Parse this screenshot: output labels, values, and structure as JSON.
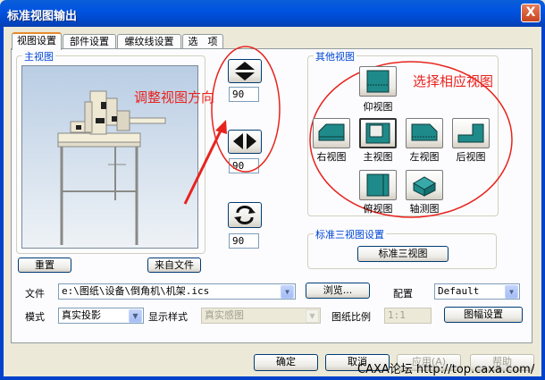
{
  "window": {
    "title": "标准视图输出",
    "close_label": "X"
  },
  "tabs": [
    "视图设置",
    "部件设置",
    "螺纹线设置",
    "选　项"
  ],
  "main_view": {
    "label": "主视图",
    "reset_label": "重置",
    "from_file_label": "来自文件"
  },
  "rotation": {
    "vertical_value": "90",
    "horizontal_value": "90",
    "spin_value": "90"
  },
  "other_views": {
    "label": "其他视图",
    "top": "仰视图",
    "right": "右视图",
    "front": "主视图",
    "left": "左视图",
    "back": "后视图",
    "bottom": "俯视图",
    "iso": "轴测图"
  },
  "standard_three": {
    "label": "标准三视图设置",
    "button_label": "标准三视图"
  },
  "annotations": {
    "adjust": "调整视图方向",
    "choose": "选择相应视图"
  },
  "form": {
    "file_label": "文件",
    "file_value": "e:\\图纸\\设备\\倒角机\\机架.ics",
    "browse_label": "浏览...",
    "config_label": "配置",
    "config_value": "Default",
    "mode_label": "模式",
    "mode_value": "真实投影",
    "display_label": "显示样式",
    "display_value": "真实感图",
    "scale_label": "图纸比例",
    "scale_value": "1:1",
    "sheet_button": "图幅设置"
  },
  "footer": {
    "ok": "确定",
    "cancel": "取消",
    "apply": "应用(A)",
    "help": "帮助"
  },
  "watermark": "CAXA论坛 http://top.caxa.com/",
  "colors": {
    "title_bar": "#0053e1",
    "annotation_red": "#e8231d",
    "group_label": "#0046d5",
    "view_icon_teal": "#1f8a8a"
  },
  "icons": [
    "close-icon",
    "arrow-up-down-icon",
    "arrow-left-right-icon",
    "rotate-icon",
    "dropdown-arrow-icon"
  ]
}
